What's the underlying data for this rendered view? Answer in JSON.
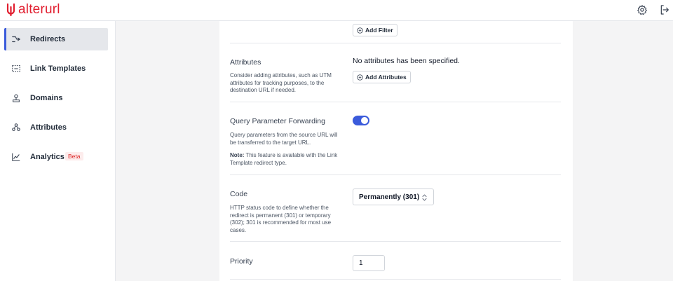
{
  "app": {
    "logo_text": "alterurl"
  },
  "header": {
    "settings_icon": "gear-icon",
    "logout_icon": "logout-icon"
  },
  "sidebar": {
    "items": [
      {
        "label": "Redirects",
        "icon": "redirect-icon",
        "active": true
      },
      {
        "label": "Link Templates",
        "icon": "link-template-icon"
      },
      {
        "label": "Domains",
        "icon": "domain-icon"
      },
      {
        "label": "Attributes",
        "icon": "attributes-icon"
      },
      {
        "label": "Analytics",
        "icon": "analytics-icon",
        "badge": "Beta"
      }
    ]
  },
  "form": {
    "filter": {
      "button_label": "Add Filter"
    },
    "attributes": {
      "title": "Attributes",
      "description": "Consider adding attributes, such as UTM attributes for tracking purposes, to the destination URL if needed.",
      "empty_text": "No attributes has been specified.",
      "button_label": "Add Attributes"
    },
    "query_forwarding": {
      "title": "Query Parameter Forwarding",
      "description": "Query parameters from the source URL will be transferred to the target URL.",
      "note_label": "Note:",
      "note_text": " This feature is available with the Link Template redirect type.",
      "enabled": true
    },
    "code": {
      "title": "Code",
      "description": "HTTP status code to define whether the redirect is permanent (301) or temporary (302); 301 is recommended for most use cases.",
      "selected": "Permanently (301)"
    },
    "priority": {
      "title": "Priority",
      "value": "1"
    }
  },
  "colors": {
    "brand": "#e11d2e",
    "accent": "#3b5bdb"
  }
}
